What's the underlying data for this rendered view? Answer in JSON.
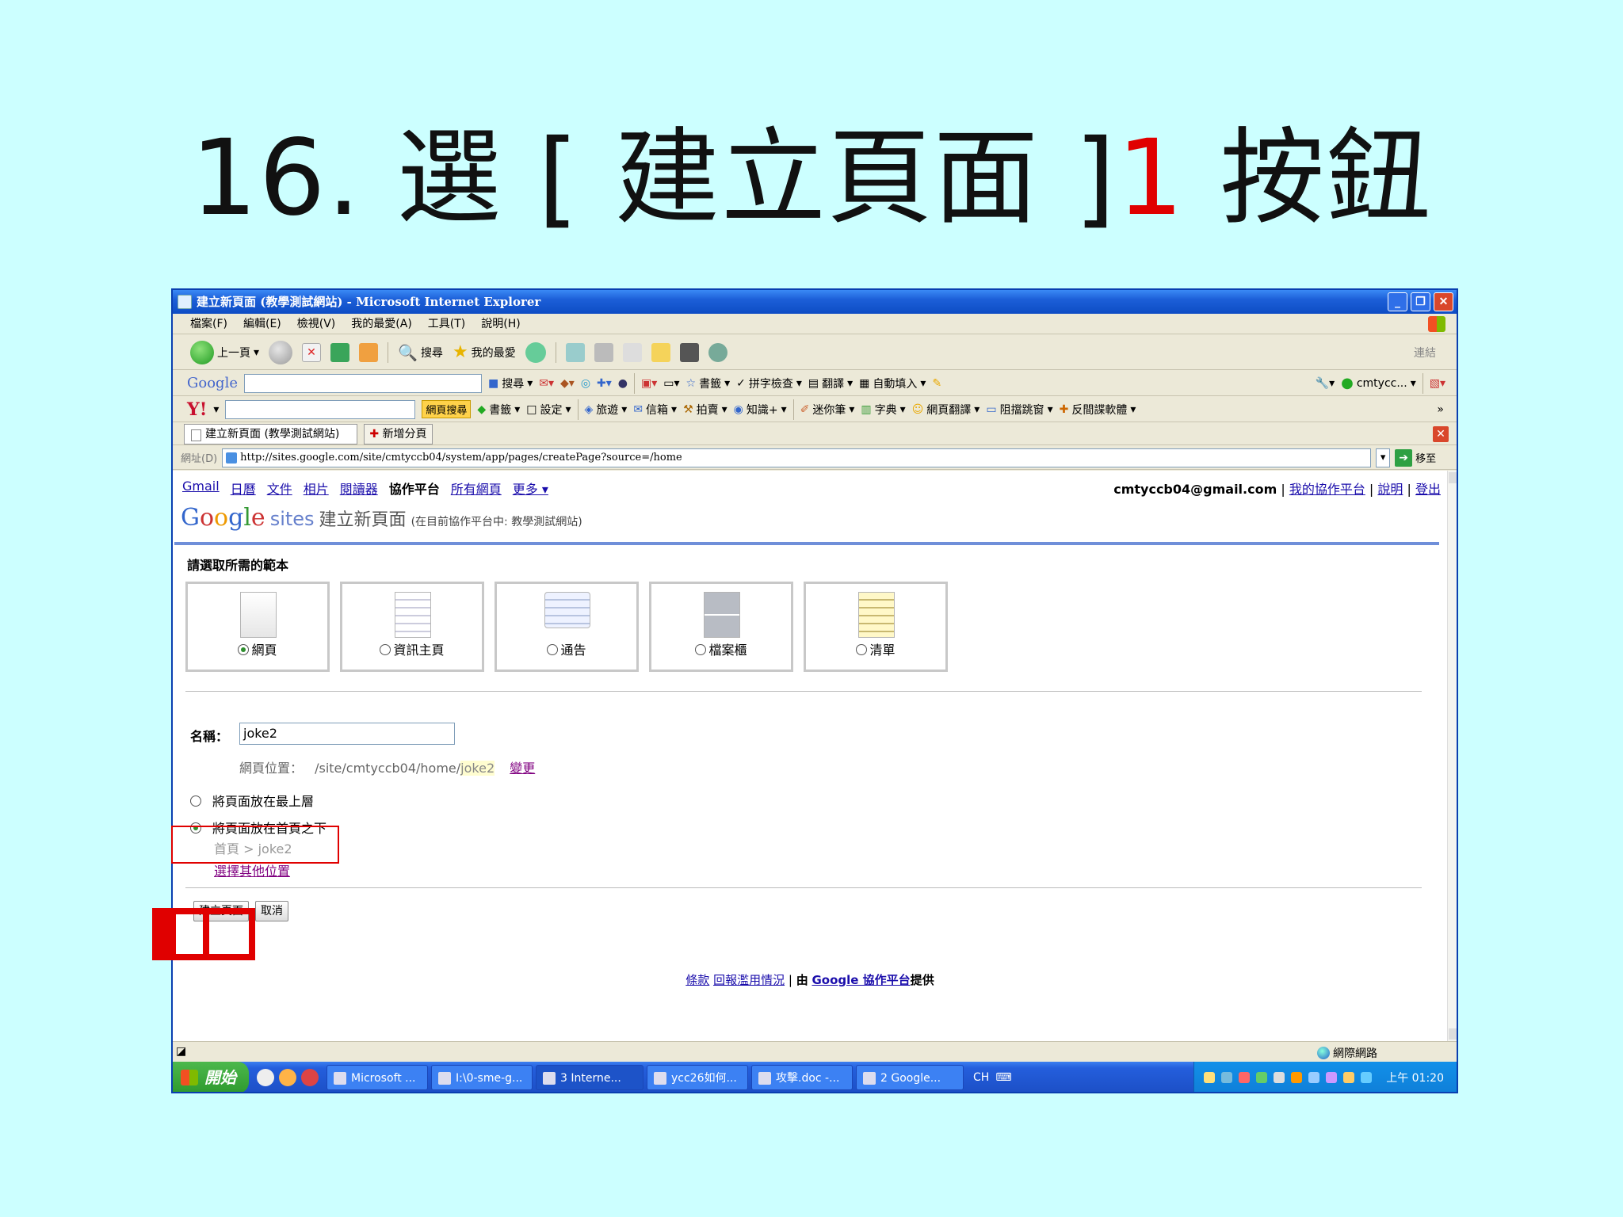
{
  "slide": {
    "title_prefix": "16. 選 [ 建立頁面 ]",
    "title_number": "1",
    "title_suffix": " 按鈕"
  },
  "window": {
    "title": "建立新頁面 (教學測試網站) - Microsoft Internet Explorer",
    "buttons": [
      "_",
      "❐",
      "✕"
    ]
  },
  "menubar": [
    "檔案(F)",
    "編輯(E)",
    "檢視(V)",
    "我的最愛(A)",
    "工具(T)",
    "說明(H)"
  ],
  "std_toolbar": {
    "back": "上一頁",
    "search": "搜尋",
    "favorites": "我的最愛",
    "links": "連結"
  },
  "google_toolbar": {
    "logo": "Google",
    "search": "搜尋",
    "bookmarks": "書籤",
    "spell": "拼字檢查",
    "translate": "翻譯",
    "autofill": "自動填入",
    "account": "cmtycc..."
  },
  "yahoo_toolbar": {
    "logo": "Y!",
    "web_search": "網頁搜尋",
    "bookmarks": "書籤",
    "settings": "設定",
    "travel": "旅遊",
    "mail": "信箱",
    "auction": "拍賣",
    "knowledge": "知識+",
    "notes": "迷你筆",
    "dictionary": "字典",
    "page_translate": "網頁翻譯",
    "popup_block": "阻擋跳窗",
    "antispy": "反間諜軟體"
  },
  "tabs": {
    "active": "建立新頁面 (教學測試網站)",
    "new_tab": "新增分頁"
  },
  "address": {
    "label": "網址(D)",
    "url": "http://sites.google.com/site/cmtyccb04/system/app/pages/createPage?source=/home",
    "go": "移至"
  },
  "gnav": {
    "items": [
      "Gmail",
      "日曆",
      "文件",
      "相片",
      "閱讀器",
      "協作平台",
      "所有網頁",
      "更多 ▾"
    ],
    "email": "cmtyccb04@gmail.com",
    "my_sites": "我的協作平台",
    "help": "說明",
    "signout": "登出"
  },
  "sites_header": {
    "logo_letters": [
      "G",
      "o",
      "o",
      "g",
      "l",
      "e"
    ],
    "sites_word": "sites",
    "page_title": "建立新頁面",
    "subtitle": "(在目前協作平台中: 教學測試網站)"
  },
  "templates": {
    "heading": "請選取所需的範本",
    "items": [
      {
        "label": "網頁",
        "selected": true
      },
      {
        "label": "資訊主頁",
        "selected": false
      },
      {
        "label": "通告",
        "selected": false
      },
      {
        "label": "檔案櫃",
        "selected": false
      },
      {
        "label": "清單",
        "selected": false
      }
    ]
  },
  "form": {
    "name_label": "名稱：",
    "name_value": "joke2",
    "location_label": "網頁位置：",
    "location_path": "/site/cmtyccb04/home/",
    "location_slug": "joke2",
    "change_link": "變更",
    "opt_top": "將頁面放在最上層",
    "opt_under": "將頁面放在首頁之下",
    "breadcrumb": "首頁 > joke2",
    "choose_other": "選擇其他位置",
    "create_button": "建立頁面",
    "cancel_button": "取消"
  },
  "footer": {
    "terms": "條款",
    "report": "回報濫用情況",
    "by": "由",
    "google_sites": "Google 協作平台",
    "provided": "提供"
  },
  "statusbar": {
    "zone": "網際網路"
  },
  "taskbar": {
    "start": "開始",
    "tasks": [
      "Microsoft ...",
      "I:\\0-sme-g...",
      "3 Interne...",
      "ycc26如何...",
      "攻擊.doc -...",
      "2 Google..."
    ],
    "lang": "CH",
    "clock": "上午 01:20"
  },
  "colors": {
    "slide_bg": "#ccffff",
    "highlight": "#e00000",
    "xp_blue": "#0d4cc4"
  }
}
